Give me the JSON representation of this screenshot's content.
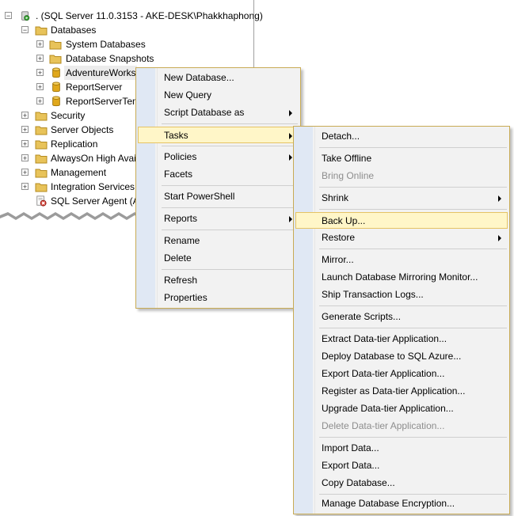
{
  "tree": {
    "server_node": ". (SQL Server 11.0.3153 - AKE-DESK\\Phakkhaphong)",
    "nodes": [
      {
        "label": "Databases",
        "expander": "−"
      },
      {
        "label": "System Databases",
        "expander": "+"
      },
      {
        "label": "Database Snapshots",
        "expander": "+"
      },
      {
        "label": "AdventureWorks",
        "expander": "+"
      },
      {
        "label": "ReportServer",
        "expander": "+"
      },
      {
        "label": "ReportServerTem",
        "expander": "+"
      },
      {
        "label": "Security",
        "expander": "+"
      },
      {
        "label": "Server Objects",
        "expander": "+"
      },
      {
        "label": "Replication",
        "expander": "+"
      },
      {
        "label": "AlwaysOn High Avai",
        "expander": "+"
      },
      {
        "label": "Management",
        "expander": "+"
      },
      {
        "label": "Integration Services (",
        "expander": "+"
      },
      {
        "label": "SQL Server Agent (A",
        "expander": ""
      }
    ],
    "server_expander": "−"
  },
  "context_menu": {
    "items": [
      "New Database...",
      "New Query",
      "Script Database as",
      "Tasks",
      "Policies",
      "Facets",
      "Start PowerShell",
      "Reports",
      "Rename",
      "Delete",
      "Refresh",
      "Properties"
    ]
  },
  "tasks_menu": {
    "items": [
      "Detach...",
      "Take Offline",
      "Bring Online",
      "Shrink",
      "Back Up...",
      "Restore",
      "Mirror...",
      "Launch Database Mirroring Monitor...",
      "Ship Transaction Logs...",
      "Generate Scripts...",
      "Extract Data-tier Application...",
      "Deploy Database to SQL Azure...",
      "Export Data-tier Application...",
      "Register as Data-tier Application...",
      "Upgrade Data-tier Application...",
      "Delete Data-tier Application...",
      "Import Data...",
      "Export Data...",
      "Copy Database...",
      "Manage Database Encryption..."
    ]
  },
  "colors": {
    "highlight_fill": "#fff6c8",
    "highlight_border": "#e5c365",
    "menu_border": "#c8ab55",
    "folder": "#e8c35a",
    "database": "#e0a81c"
  }
}
